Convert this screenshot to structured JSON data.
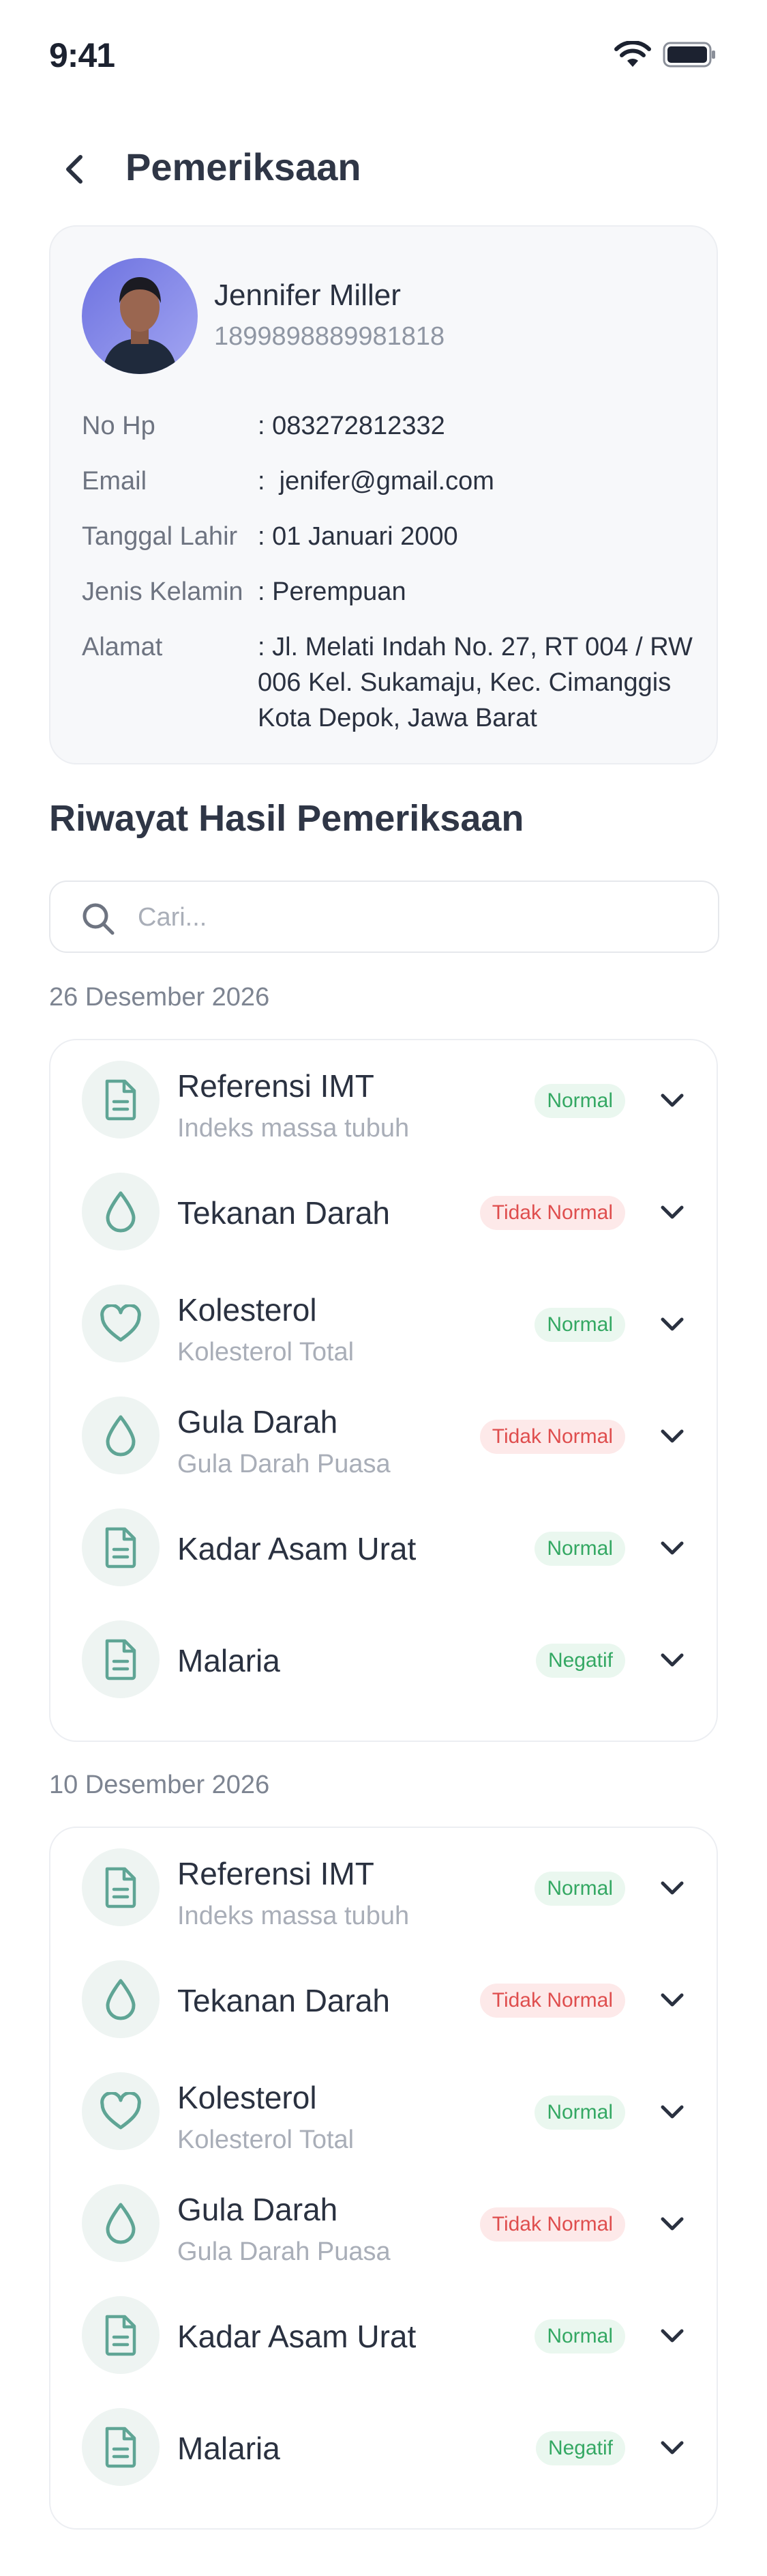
{
  "status": {
    "time": "9:41"
  },
  "header": {
    "title": "Pemeriksaan"
  },
  "patient": {
    "name": "Jennifer Miller",
    "id": "1899898889981818",
    "fields": [
      {
        "label": "No Hp",
        "value": ": 083272812332"
      },
      {
        "label": "Email",
        "value": ":  jenifer@gmail.com"
      },
      {
        "label": "Tanggal Lahir",
        "value": ": 01 Januari 2000"
      },
      {
        "label": "Jenis Kelamin",
        "value": ": Perempuan"
      },
      {
        "label": "Alamat",
        "value": ": Jl. Melati Indah No. 27, RT 004 / RW 006 Kel. Sukamaju, Kec. Cimanggis Kota Depok, Jawa Barat"
      }
    ]
  },
  "history": {
    "title": "Riwayat Hasil Pemeriksaan",
    "search_placeholder": "Cari...",
    "groups": [
      {
        "date": "26 Desember 2026",
        "items": [
          {
            "icon": "document-icon",
            "title": "Referensi IMT",
            "subtitle": "Indeks massa tubuh",
            "status": "Normal",
            "status_type": "ok"
          },
          {
            "icon": "drop-icon",
            "title": "Tekanan Darah",
            "subtitle": "",
            "status": "Tidak Normal",
            "status_type": "bad"
          },
          {
            "icon": "heart-icon",
            "title": "Kolesterol",
            "subtitle": "Kolesterol Total",
            "status": "Normal",
            "status_type": "ok"
          },
          {
            "icon": "drop-icon",
            "title": "Gula Darah",
            "subtitle": "Gula Darah Puasa",
            "status": "Tidak Normal",
            "status_type": "bad"
          },
          {
            "icon": "document-icon",
            "title": "Kadar Asam Urat",
            "subtitle": "",
            "status": "Normal",
            "status_type": "ok"
          },
          {
            "icon": "document-icon",
            "title": "Malaria",
            "subtitle": "",
            "status": "Negatif",
            "status_type": "ok"
          }
        ]
      },
      {
        "date": "10 Desember 2026",
        "items": [
          {
            "icon": "document-icon",
            "title": "Referensi IMT",
            "subtitle": "Indeks massa tubuh",
            "status": "Normal",
            "status_type": "ok"
          },
          {
            "icon": "drop-icon",
            "title": "Tekanan Darah",
            "subtitle": "",
            "status": "Tidak Normal",
            "status_type": "bad"
          },
          {
            "icon": "heart-icon",
            "title": "Kolesterol",
            "subtitle": "Kolesterol Total",
            "status": "Normal",
            "status_type": "ok"
          },
          {
            "icon": "drop-icon",
            "title": "Gula Darah",
            "subtitle": "Gula Darah Puasa",
            "status": "Tidak Normal",
            "status_type": "bad"
          },
          {
            "icon": "document-icon",
            "title": "Kadar Asam Urat",
            "subtitle": "",
            "status": "Normal",
            "status_type": "ok"
          },
          {
            "icon": "document-icon",
            "title": "Malaria",
            "subtitle": "",
            "status": "Negatif",
            "status_type": "ok"
          }
        ]
      }
    ]
  },
  "colors": {
    "accent": "#5fa595",
    "ok": "#34a863",
    "bad": "#df4e4e"
  }
}
